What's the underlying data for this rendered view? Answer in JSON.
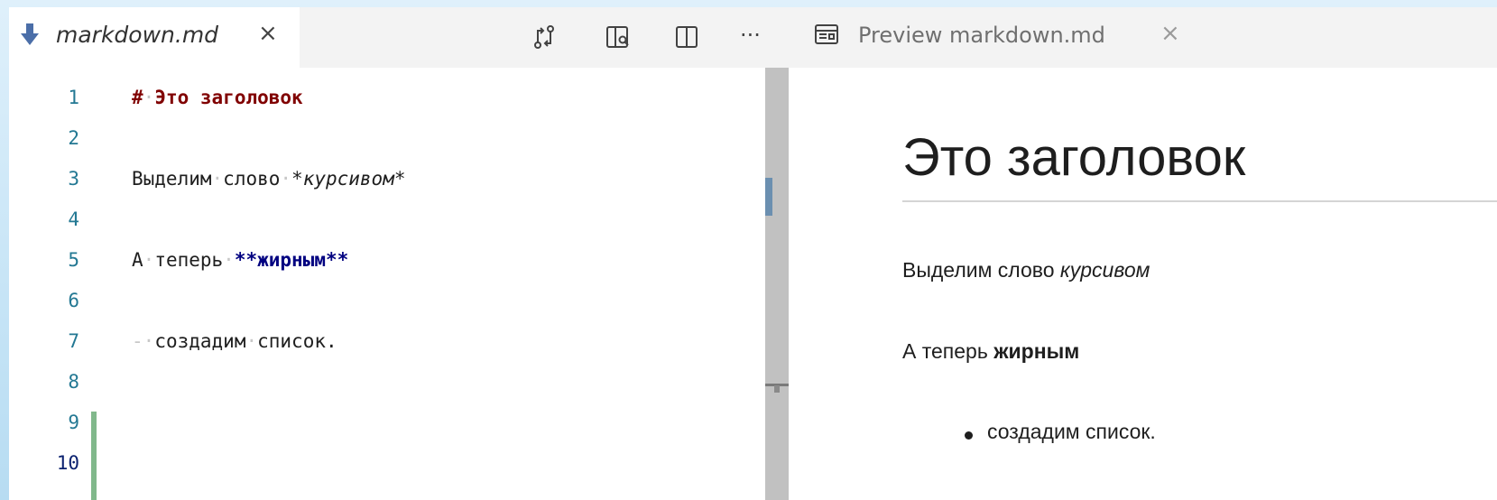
{
  "editor": {
    "tab": {
      "title": "markdown.md",
      "close": "×"
    },
    "toolbar": {
      "more": "···"
    },
    "lines": [
      {
        "n": "1"
      },
      {
        "n": "2"
      },
      {
        "n": "3"
      },
      {
        "n": "4"
      },
      {
        "n": "5"
      },
      {
        "n": "6"
      },
      {
        "n": "7"
      },
      {
        "n": "8"
      },
      {
        "n": "9"
      },
      {
        "n": "10"
      }
    ],
    "code": {
      "line1": {
        "marker": "#",
        "text": "Это заголовок"
      },
      "line3": {
        "text1": "Выделим",
        "text2": "слово",
        "emphasis": "*курсивом*"
      },
      "line5": {
        "text1": "А",
        "text2": "теперь",
        "strong": "**жирным**"
      },
      "line7": {
        "marker": "-",
        "text1": "создадим",
        "text2": "список."
      }
    }
  },
  "preview": {
    "tab": {
      "title": "Preview markdown.md",
      "close": "×"
    },
    "heading": "Это заголовок",
    "p1": {
      "text": "Выделим слово ",
      "em": "курсивом"
    },
    "p2": {
      "text": "А теперь ",
      "strong": "жирным"
    },
    "list": [
      "создадим список."
    ]
  },
  "colors": {
    "line_number": "#237893",
    "heading_markup": "#800000",
    "bold_markup": "#000080",
    "change_bar": "#81b88b"
  }
}
